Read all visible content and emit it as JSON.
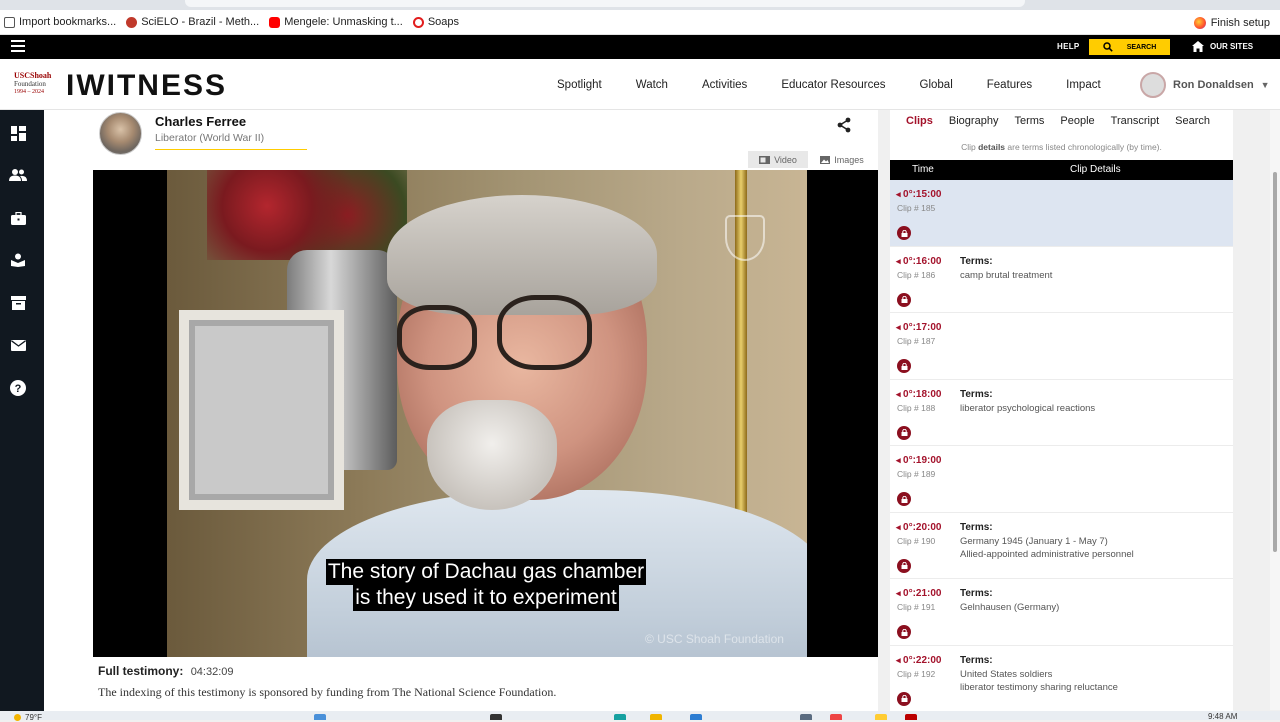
{
  "bookmarks": [
    {
      "label": "Import bookmarks...",
      "color": "#555555"
    },
    {
      "label": "SciELO - Brazil - Meth...",
      "color": "#c0392b"
    },
    {
      "label": "Mengele: Unmasking t...",
      "color": "#ff0000"
    },
    {
      "label": "Soaps",
      "color": "#e21d1d"
    }
  ],
  "finish_setup": "Finish setup",
  "topbar": {
    "help": "HELP",
    "search": "SEARCH",
    "our_sites": "OUR SITES"
  },
  "logo": {
    "line1": "USCShoah",
    "line2": "Foundation",
    "line3": "1994 – 2024"
  },
  "brand": "IWITNESS",
  "nav": [
    "Spotlight",
    "Watch",
    "Activities",
    "Educator Resources",
    "Global",
    "Features",
    "Impact"
  ],
  "user": {
    "name": "Ron Donaldsen"
  },
  "speaker": {
    "name": "Charles Ferree",
    "role": "Liberator (World War II)"
  },
  "media_tabs": {
    "video": "Video",
    "images": "Images"
  },
  "video": {
    "subtitle_line1": "The story of Dachau gas chamber",
    "subtitle_line2": "is they used it to experiment",
    "watermark": "© USC Shoah Foundation"
  },
  "testimony": {
    "label": "Full testimony:",
    "duration": "04:32:09",
    "sponsor": "The indexing of this testimony is sponsored by funding from The National Science Foundation."
  },
  "panel": {
    "tabs": [
      "Clips",
      "Biography",
      "Terms",
      "People",
      "Transcript",
      "Search"
    ],
    "note_pre": "Clip ",
    "note_bold": "details",
    "note_post": " are terms listed chronologically (by time).",
    "col_time": "Time",
    "col_details": "Clip Details",
    "terms_label": "Terms:"
  },
  "clips": [
    {
      "time": "0°:15:00",
      "num": "Clip # 185",
      "terms": []
    },
    {
      "time": "0°:16:00",
      "num": "Clip # 186",
      "terms": [
        "camp brutal treatment"
      ]
    },
    {
      "time": "0°:17:00",
      "num": "Clip # 187",
      "terms": []
    },
    {
      "time": "0°:18:00",
      "num": "Clip # 188",
      "terms": [
        "liberator psychological reactions"
      ]
    },
    {
      "time": "0°:19:00",
      "num": "Clip # 189",
      "terms": []
    },
    {
      "time": "0°:20:00",
      "num": "Clip # 190",
      "terms": [
        "Germany 1945 (January 1 - May 7)",
        "Allied-appointed administrative personnel"
      ]
    },
    {
      "time": "0°:21:00",
      "num": "Clip # 191",
      "terms": [
        "Gelnhausen (Germany)"
      ]
    },
    {
      "time": "0°:22:00",
      "num": "Clip # 192",
      "terms": [
        "United States soldiers",
        "liberator testimony sharing reluctance"
      ]
    }
  ],
  "sidebar_icons": [
    "dashboard-icon",
    "people-icon",
    "briefcase-icon",
    "school-icon",
    "archive-icon",
    "mail-icon",
    "help-icon"
  ],
  "taskbar": {
    "weather": "79°F",
    "clock": "9:48 AM"
  },
  "colors": {
    "accent": "#ffcc00",
    "brand_red": "#a3122b",
    "sidebar": "#111820"
  }
}
